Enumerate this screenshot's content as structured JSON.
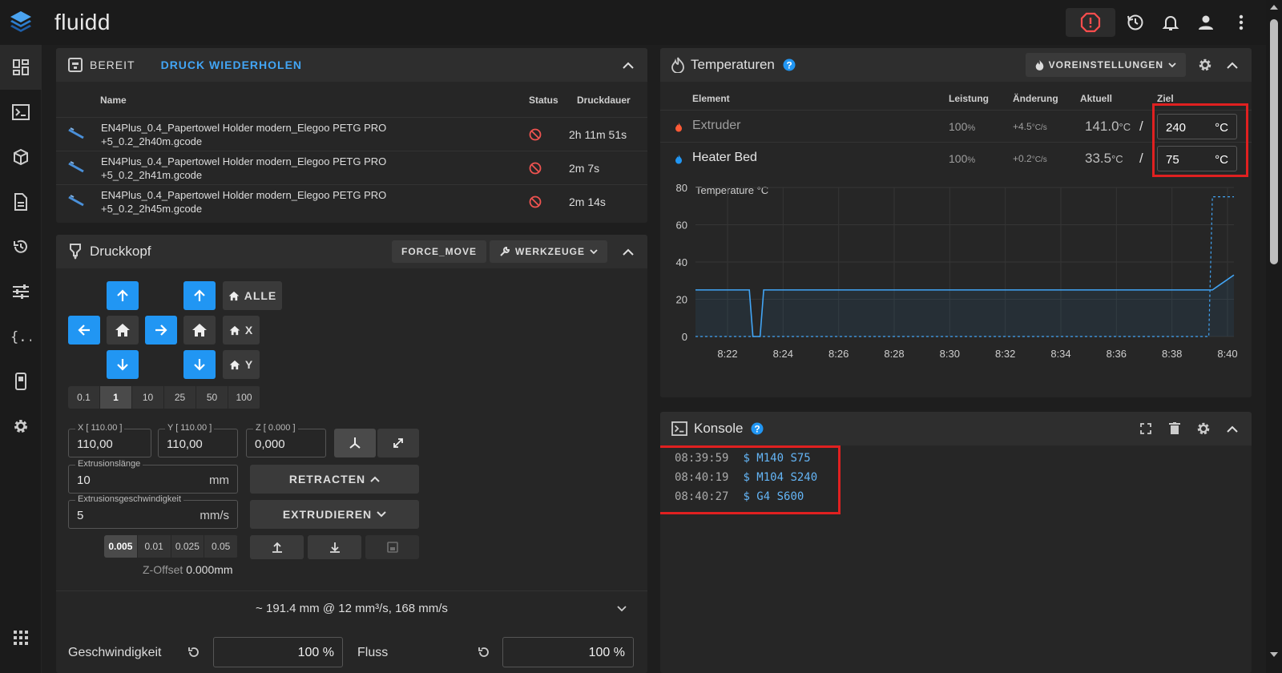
{
  "app": {
    "brand": "fluidd"
  },
  "icons": {
    "logo": "layers-icon",
    "estop": "emergency-stop-icon",
    "restart": "restart-icon",
    "bell": "bell-icon",
    "user": "user-icon",
    "more": "more-vert-icon"
  },
  "colors": {
    "accent": "#2196f3",
    "estop": "#ff4d4d",
    "highlight": "#e02020",
    "heater": "#ff5a36"
  },
  "jobs": {
    "status_label": "BEREIT",
    "reprint_label": "DRUCK WIEDERHOLEN",
    "headers": {
      "name": "Name",
      "status": "Status",
      "duration": "Druckdauer"
    },
    "rows": [
      {
        "name_line1": "EN4Plus_0.4_Papertowel Holder modern_Elegoo PETG PRO",
        "name_line2": "+5_0.2_2h40m.gcode",
        "duration": "2h 11m 51s"
      },
      {
        "name_line1": "EN4Plus_0.4_Papertowel Holder modern_Elegoo PETG PRO",
        "name_line2": "+5_0.2_2h41m.gcode",
        "duration": "2m 7s"
      },
      {
        "name_line1": "EN4Plus_0.4_Papertowel Holder modern_Elegoo PETG PRO",
        "name_line2": "+5_0.2_2h45m.gcode",
        "duration": "2m 14s"
      }
    ]
  },
  "toolhead": {
    "title": "Druckkopf",
    "force_move": "FORCE_MOVE",
    "tools": "WERKZEUGE",
    "home_all": "ALLE",
    "home_x": "X",
    "home_y": "Y",
    "steps": [
      "0.1",
      "1",
      "10",
      "25",
      "50",
      "100"
    ],
    "step_selected": "1",
    "x_label": "X [ 110.00 ]",
    "x_value": "110,00",
    "y_label": "Y [ 110.00 ]",
    "y_value": "110,00",
    "z_label": "Z [ 0.000 ]",
    "z_value": "0,000",
    "extrude_length_label": "Extrusionslänge",
    "extrude_length": "10",
    "extrude_length_unit": "mm",
    "extrude_speed_label": "Extrusionsgeschwindigkeit",
    "extrude_speed": "5",
    "extrude_speed_unit": "mm/s",
    "retract": "RETRACTEN",
    "extrude": "EXTRUDIEREN",
    "zsteps": [
      "0.005",
      "0.01",
      "0.025",
      "0.05"
    ],
    "zstep_selected": "0.005",
    "zoffset_label": "Z-Offset",
    "zoffset_value": "0.000mm",
    "flow_summary": "~ 191.4 mm @ 12 mm³/s, 168 mm/s",
    "speed_label": "Geschwindigkeit",
    "speed_value": "100 %",
    "flow_label": "Fluss",
    "flow_value": "100 %"
  },
  "temps": {
    "title": "Temperaturen",
    "presets": "VOREINSTELLUNGEN",
    "headers": {
      "element": "Element",
      "power": "Leistung",
      "change": "Änderung",
      "current": "Aktuell",
      "target": "Ziel"
    },
    "rows": [
      {
        "name": "Extruder",
        "power": "100",
        "power_unit": "%",
        "change": "+4.5",
        "change_unit": "°C/s",
        "current": "141.0",
        "current_unit": "°C",
        "sep": "/",
        "target": "240",
        "target_unit": "°C"
      },
      {
        "name": "Heater Bed",
        "power": "100",
        "power_unit": "%",
        "change": "+0.2",
        "change_unit": "°C/s",
        "current": "33.5",
        "current_unit": "°C",
        "sep": "/",
        "target": "75",
        "target_unit": "°C"
      }
    ]
  },
  "chart_data": {
    "type": "line",
    "ylabel": "Temperature °C",
    "ylim": [
      0,
      80
    ],
    "yticks": [
      "0",
      "20",
      "40",
      "60",
      "80"
    ],
    "xticks": [
      "8:22",
      "8:24",
      "8:26",
      "8:28",
      "8:30",
      "8:32",
      "8:34",
      "8:36",
      "8:38",
      "8:40"
    ],
    "series": [
      {
        "x": [
          8.3,
          8.4,
          8.45,
          8.46,
          8.48,
          8.49,
          8.5,
          8.6,
          8.7,
          8.8,
          8.9,
          9.0,
          9.1,
          9.2,
          9.3,
          9.4,
          9.5,
          9.6,
          9.65,
          9.74,
          9.8
        ],
        "y": [
          25,
          25,
          25,
          0,
          0,
          25,
          25,
          25,
          25,
          25,
          25,
          25,
          25,
          25,
          25,
          25,
          25,
          25,
          25,
          25,
          33
        ],
        "style": "solid"
      },
      {
        "x": [
          8.3,
          9.73,
          9.74,
          9.8
        ],
        "y": [
          0,
          0,
          75,
          75
        ],
        "style": "dashed"
      }
    ],
    "grid": true
  },
  "console": {
    "title": "Konsole",
    "lines": [
      {
        "time": "08:39:59",
        "cmd": "$ M140 S75"
      },
      {
        "time": "08:40:19",
        "cmd": "$ M104 S240"
      },
      {
        "time": "08:40:27",
        "cmd": "$ G4 S600"
      }
    ]
  }
}
